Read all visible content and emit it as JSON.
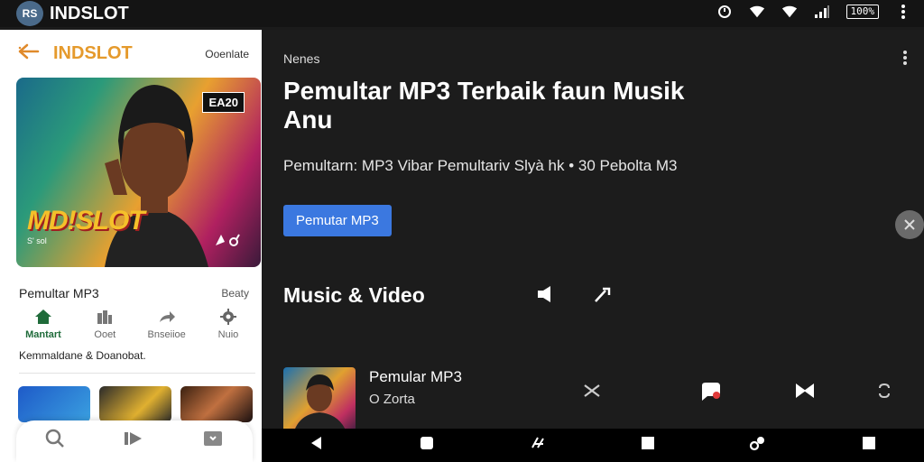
{
  "statusbar": {
    "app_name": "INDSLOT",
    "logo_text": "RS",
    "battery": "100%",
    "icons": [
      "alarm-icon",
      "wifi-icon",
      "wifi-icon",
      "signal-icon",
      "battery-icon",
      "more-vert-icon"
    ]
  },
  "left": {
    "brand": "INDSLOT",
    "header_action": "Ooenlate",
    "hero": {
      "badge": "EA20",
      "logo": "MD!SLOT",
      "caption": "S' sol"
    },
    "section_title": "Pemultar MP3",
    "section_right": "Beaty",
    "nav": [
      {
        "label": "Mantart",
        "icon": "home-icon",
        "active": true
      },
      {
        "label": "Ooet",
        "icon": "books-icon",
        "active": false
      },
      {
        "label": "Bnseiioe",
        "icon": "share-icon",
        "active": false
      },
      {
        "label": "Nuio",
        "icon": "gear-icon",
        "active": false
      }
    ],
    "caption": "Kemmaldane & Doanobat."
  },
  "right": {
    "small_label": "Nenes",
    "title": "Pemultar MP3 Terbaik faun Musik Anu",
    "description": "Pemultarn: MP3 Vibar Pemultariv Slyà hk • 30 Pebolta M3",
    "button": "Pemutar MP3",
    "section_title": "Music & Video",
    "now_playing": {
      "title": "Pemular MP3",
      "subtitle": "O Zorta"
    }
  },
  "colors": {
    "brand_orange": "#e59a2c",
    "accent_blue": "#3b78e0",
    "active_green": "#1f6b3a"
  }
}
